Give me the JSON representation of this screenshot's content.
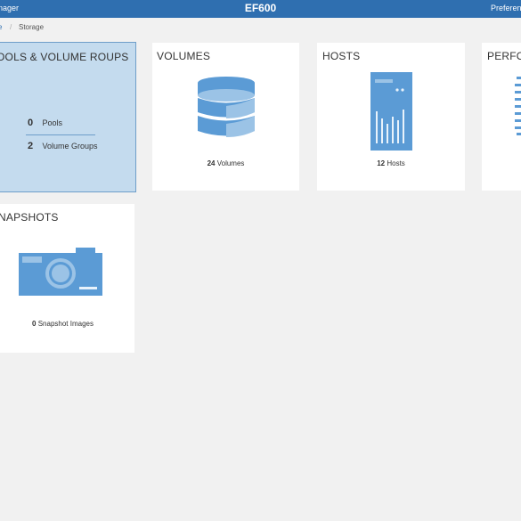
{
  "header": {
    "app_title_fragment": "nager",
    "system_name": "EF600",
    "preferences_fragment": "Preferenc"
  },
  "breadcrumb": {
    "home_fragment": "e",
    "separator": "/",
    "current": "Storage"
  },
  "tiles": {
    "pools": {
      "title": "OOLS & VOLUME ROUPS",
      "pools_count": "0",
      "pools_label": "Pools",
      "groups_count": "2",
      "groups_label": "Volume Groups"
    },
    "volumes": {
      "title": "VOLUMES",
      "count": "24",
      "label": "Volumes",
      "icon": "database-icon"
    },
    "hosts": {
      "title": "HOSTS",
      "count": "12",
      "label": "Hosts",
      "icon": "server-icon"
    },
    "performance": {
      "title": "PERFO",
      "icon": "performance-icon"
    },
    "snapshots": {
      "title": "NAPSHOTS",
      "count": "0",
      "label": "Snapshot Images",
      "icon": "camera-icon"
    }
  },
  "colors": {
    "header_bg": "#2f6fb0",
    "icon_blue": "#5b9bd5",
    "selected_tile_bg": "#c4dbee"
  }
}
